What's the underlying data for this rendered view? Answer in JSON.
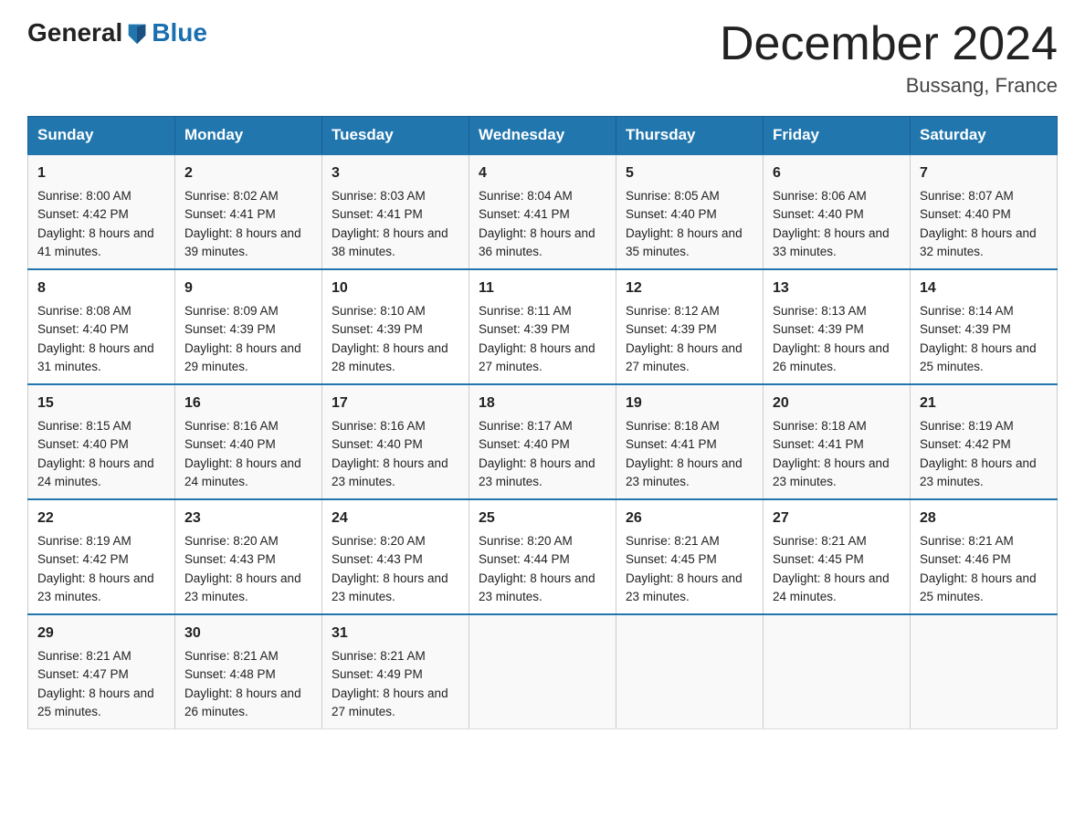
{
  "logo": {
    "part1": "General",
    "part2": "Blue"
  },
  "title": "December 2024",
  "subtitle": "Bussang, France",
  "days": [
    "Sunday",
    "Monday",
    "Tuesday",
    "Wednesday",
    "Thursday",
    "Friday",
    "Saturday"
  ],
  "weeks": [
    [
      {
        "day": "1",
        "sunrise": "8:00 AM",
        "sunset": "4:42 PM",
        "daylight": "8 hours and 41 minutes."
      },
      {
        "day": "2",
        "sunrise": "8:02 AM",
        "sunset": "4:41 PM",
        "daylight": "8 hours and 39 minutes."
      },
      {
        "day": "3",
        "sunrise": "8:03 AM",
        "sunset": "4:41 PM",
        "daylight": "8 hours and 38 minutes."
      },
      {
        "day": "4",
        "sunrise": "8:04 AM",
        "sunset": "4:41 PM",
        "daylight": "8 hours and 36 minutes."
      },
      {
        "day": "5",
        "sunrise": "8:05 AM",
        "sunset": "4:40 PM",
        "daylight": "8 hours and 35 minutes."
      },
      {
        "day": "6",
        "sunrise": "8:06 AM",
        "sunset": "4:40 PM",
        "daylight": "8 hours and 33 minutes."
      },
      {
        "day": "7",
        "sunrise": "8:07 AM",
        "sunset": "4:40 PM",
        "daylight": "8 hours and 32 minutes."
      }
    ],
    [
      {
        "day": "8",
        "sunrise": "8:08 AM",
        "sunset": "4:40 PM",
        "daylight": "8 hours and 31 minutes."
      },
      {
        "day": "9",
        "sunrise": "8:09 AM",
        "sunset": "4:39 PM",
        "daylight": "8 hours and 29 minutes."
      },
      {
        "day": "10",
        "sunrise": "8:10 AM",
        "sunset": "4:39 PM",
        "daylight": "8 hours and 28 minutes."
      },
      {
        "day": "11",
        "sunrise": "8:11 AM",
        "sunset": "4:39 PM",
        "daylight": "8 hours and 27 minutes."
      },
      {
        "day": "12",
        "sunrise": "8:12 AM",
        "sunset": "4:39 PM",
        "daylight": "8 hours and 27 minutes."
      },
      {
        "day": "13",
        "sunrise": "8:13 AM",
        "sunset": "4:39 PM",
        "daylight": "8 hours and 26 minutes."
      },
      {
        "day": "14",
        "sunrise": "8:14 AM",
        "sunset": "4:39 PM",
        "daylight": "8 hours and 25 minutes."
      }
    ],
    [
      {
        "day": "15",
        "sunrise": "8:15 AM",
        "sunset": "4:40 PM",
        "daylight": "8 hours and 24 minutes."
      },
      {
        "day": "16",
        "sunrise": "8:16 AM",
        "sunset": "4:40 PM",
        "daylight": "8 hours and 24 minutes."
      },
      {
        "day": "17",
        "sunrise": "8:16 AM",
        "sunset": "4:40 PM",
        "daylight": "8 hours and 23 minutes."
      },
      {
        "day": "18",
        "sunrise": "8:17 AM",
        "sunset": "4:40 PM",
        "daylight": "8 hours and 23 minutes."
      },
      {
        "day": "19",
        "sunrise": "8:18 AM",
        "sunset": "4:41 PM",
        "daylight": "8 hours and 23 minutes."
      },
      {
        "day": "20",
        "sunrise": "8:18 AM",
        "sunset": "4:41 PM",
        "daylight": "8 hours and 23 minutes."
      },
      {
        "day": "21",
        "sunrise": "8:19 AM",
        "sunset": "4:42 PM",
        "daylight": "8 hours and 23 minutes."
      }
    ],
    [
      {
        "day": "22",
        "sunrise": "8:19 AM",
        "sunset": "4:42 PM",
        "daylight": "8 hours and 23 minutes."
      },
      {
        "day": "23",
        "sunrise": "8:20 AM",
        "sunset": "4:43 PM",
        "daylight": "8 hours and 23 minutes."
      },
      {
        "day": "24",
        "sunrise": "8:20 AM",
        "sunset": "4:43 PM",
        "daylight": "8 hours and 23 minutes."
      },
      {
        "day": "25",
        "sunrise": "8:20 AM",
        "sunset": "4:44 PM",
        "daylight": "8 hours and 23 minutes."
      },
      {
        "day": "26",
        "sunrise": "8:21 AM",
        "sunset": "4:45 PM",
        "daylight": "8 hours and 23 minutes."
      },
      {
        "day": "27",
        "sunrise": "8:21 AM",
        "sunset": "4:45 PM",
        "daylight": "8 hours and 24 minutes."
      },
      {
        "day": "28",
        "sunrise": "8:21 AM",
        "sunset": "4:46 PM",
        "daylight": "8 hours and 25 minutes."
      }
    ],
    [
      {
        "day": "29",
        "sunrise": "8:21 AM",
        "sunset": "4:47 PM",
        "daylight": "8 hours and 25 minutes."
      },
      {
        "day": "30",
        "sunrise": "8:21 AM",
        "sunset": "4:48 PM",
        "daylight": "8 hours and 26 minutes."
      },
      {
        "day": "31",
        "sunrise": "8:21 AM",
        "sunset": "4:49 PM",
        "daylight": "8 hours and 27 minutes."
      },
      null,
      null,
      null,
      null
    ]
  ]
}
